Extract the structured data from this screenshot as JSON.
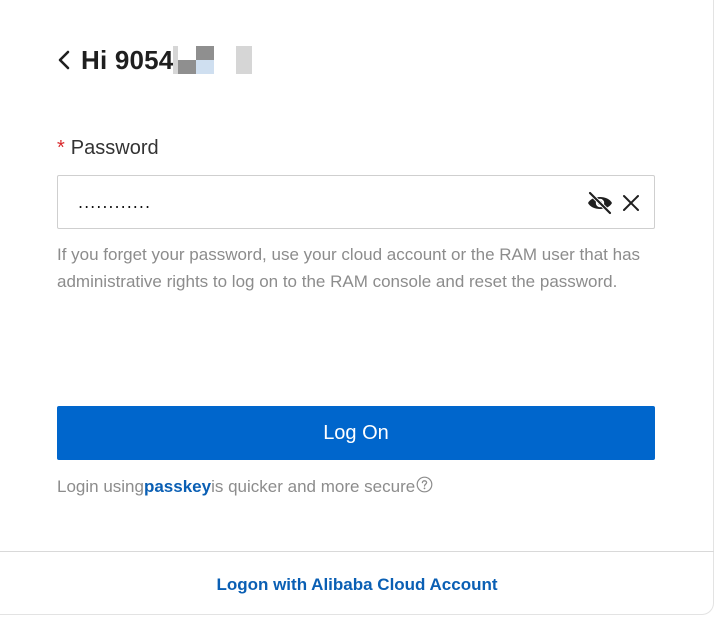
{
  "header": {
    "back_icon": "chevron-left-icon",
    "greeting": "Hi 9054",
    "masked_username_colors": [
      "#d6d6d6",
      "#8f8f8f",
      "#cfdff0",
      "#d6d6d6"
    ]
  },
  "password": {
    "required_mark": "*",
    "label": "Password",
    "value": "............",
    "visibility_icon": "eye-off-icon",
    "clear_icon": "close-icon"
  },
  "hint": "If you forget your password, use your cloud account or the RAM user that has administrative rights to log on to the RAM console and reset the password.",
  "login_button": "Log On",
  "passkey": {
    "prefix": "Login using",
    "link": "passkey",
    "suffix": "is quicker and more secure",
    "help_icon": "question-circle-icon"
  },
  "footer": {
    "link": "Logon with Alibaba Cloud Account"
  },
  "colors": {
    "primary": "#0066cc",
    "link": "#0a5fb4",
    "required": "#d9292c",
    "hint_text": "#8c8c8c"
  }
}
